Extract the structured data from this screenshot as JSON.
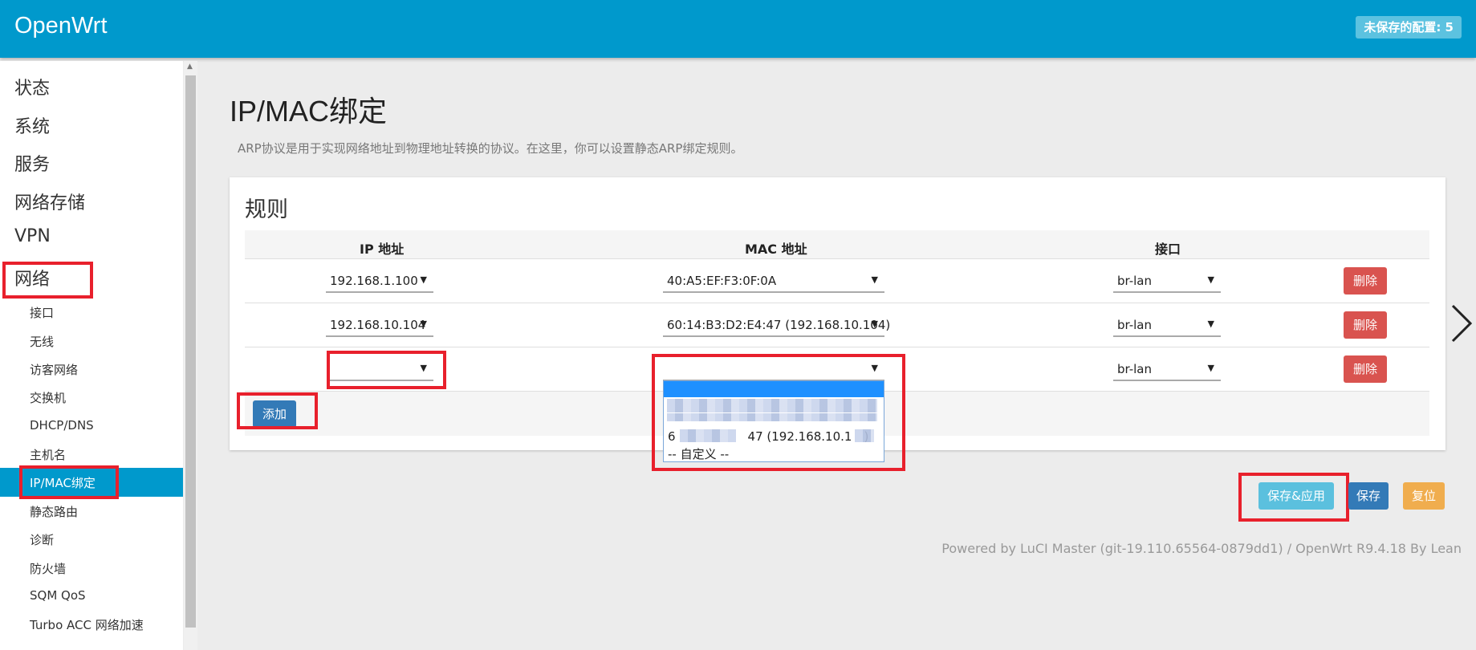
{
  "header": {
    "brand": "OpenWrt",
    "unsaved_badge": "未保存的配置: 5"
  },
  "sidebar": {
    "top_items": [
      "状态",
      "系统",
      "服务",
      "网络存储",
      "VPN",
      "网络"
    ],
    "sub_items": [
      "接口",
      "无线",
      "访客网络",
      "交换机",
      "DHCP/DNS",
      "主机名",
      "IP/MAC绑定",
      "静态路由",
      "诊断",
      "防火墙",
      "SQM QoS",
      "Turbo ACC 网络加速"
    ],
    "active_item": "IP/MAC绑定"
  },
  "page": {
    "title": "IP/MAC绑定",
    "description": "ARP协议是用于实现网络地址到物理地址转换的协议。在这里，你可以设置静态ARP绑定规则。"
  },
  "rules": {
    "section_title": "规则",
    "columns": [
      "IP 地址",
      "MAC 地址",
      "接口"
    ],
    "rows": [
      {
        "ip": "192.168.1.100",
        "mac": "40:A5:EF:F3:0F:0A",
        "iface": "br-lan",
        "delete_label": "删除"
      },
      {
        "ip": "192.168.10.104",
        "mac": "60:14:B3:D2:E4:47 (192.168.10.104)",
        "iface": "br-lan",
        "delete_label": "删除"
      },
      {
        "ip": "",
        "mac": "",
        "iface": "br-lan",
        "delete_label": "删除"
      }
    ],
    "add_label": "添加",
    "mac_dropdown_options": [
      "",
      "",
      "6　　　　　　47 (192.168.10.1　)",
      "-- 自定义 --"
    ]
  },
  "actions": {
    "save_apply": "保存&应用",
    "save": "保存",
    "reset": "复位"
  },
  "footer": "Powered by LuCI Master (git-19.110.65564-0879dd1) / OpenWrt R9.4.18 By Lean",
  "colors": {
    "header": "#0099cc",
    "delete": "#d9534f",
    "primary": "#337ab7",
    "info": "#5bc0de",
    "warning": "#f0ad4e",
    "annotation": "#e8202c"
  }
}
